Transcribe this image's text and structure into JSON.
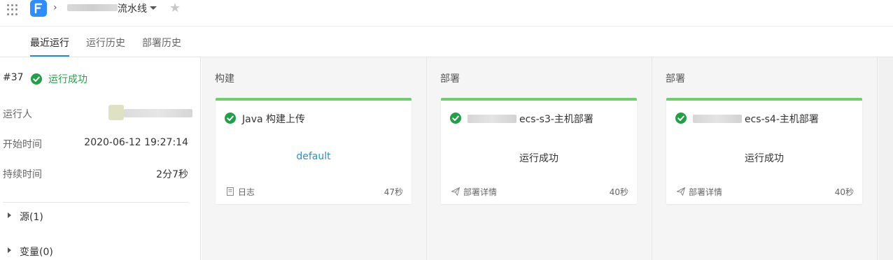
{
  "breadcrumb": {
    "title": "流水线"
  },
  "tabs": [
    {
      "label": "最近运行",
      "active": true
    },
    {
      "label": "运行历史",
      "active": false
    },
    {
      "label": "部署历史",
      "active": false
    }
  ],
  "run": {
    "number": "#37",
    "status": "运行成功",
    "status_color": "#21a046",
    "runner_label": "运行人",
    "start_label": "开始时间",
    "start_value": "2020-06-12 19:27:14",
    "duration_label": "持续时间",
    "duration_value": "2分7秒",
    "sections": [
      "源(1)",
      "变量(0)"
    ]
  },
  "stages": [
    {
      "title": "构建",
      "job": {
        "name": "Java 构建上传",
        "center_text": "default",
        "center_is_link": true,
        "footer_icon": "document-icon",
        "footer_label": "日志",
        "duration": "47秒"
      }
    },
    {
      "title": "部署",
      "job": {
        "name": "ecs-s3-主机部署",
        "center_text": "运行成功",
        "center_is_link": false,
        "footer_icon": "send-icon",
        "footer_label": "部署详情",
        "duration": "40秒"
      }
    },
    {
      "title": "部署",
      "job": {
        "name": "ecs-s4-主机部署",
        "center_text": "运行成功",
        "center_is_link": false,
        "footer_icon": "send-icon",
        "footer_label": "部署详情",
        "duration": "40秒"
      }
    }
  ],
  "colors": {
    "accent": "#1f8ad8",
    "success": "#21a046",
    "card_top_bar": "#6fcf6f",
    "link": "#2b8fd6"
  }
}
